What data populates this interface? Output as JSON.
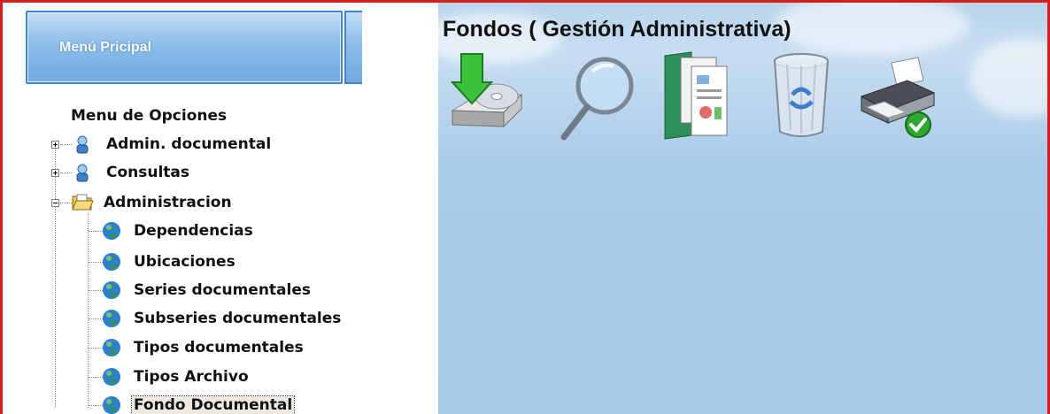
{
  "left_panel": {
    "menu_button_label": "Menú Pricipal",
    "tree_title": "Menu de Opciones",
    "items": [
      {
        "label": "Admin. documental",
        "icon": "user-icon",
        "expanded": false
      },
      {
        "label": "Consultas",
        "icon": "user-icon",
        "expanded": false
      },
      {
        "label": "Administracion",
        "icon": "folder-open-icon",
        "expanded": true
      }
    ],
    "children": [
      {
        "label": "Dependencias",
        "icon": "globe-icon"
      },
      {
        "label": "Ubicaciones",
        "icon": "globe-icon"
      },
      {
        "label": "Series documentales",
        "icon": "globe-icon"
      },
      {
        "label": "Subseries documentales",
        "icon": "globe-icon"
      },
      {
        "label": "Tipos documentales",
        "icon": "globe-icon"
      },
      {
        "label": "Tipos Archivo",
        "icon": "globe-icon"
      },
      {
        "label": "Fondo Documental",
        "icon": "globe-icon",
        "selected": true
      }
    ]
  },
  "main": {
    "title": "Fondos ( Gestión Administrativa)",
    "toolbar": [
      {
        "name": "save-disk-icon"
      },
      {
        "name": "search-magnifier-icon"
      },
      {
        "name": "documents-icon"
      },
      {
        "name": "recycle-bin-icon"
      },
      {
        "name": "printer-icon"
      }
    ]
  },
  "colors": {
    "frame_border": "#d81c1c",
    "panel_sky": "#a9cbe9",
    "menu_button": "#8dbde9"
  }
}
